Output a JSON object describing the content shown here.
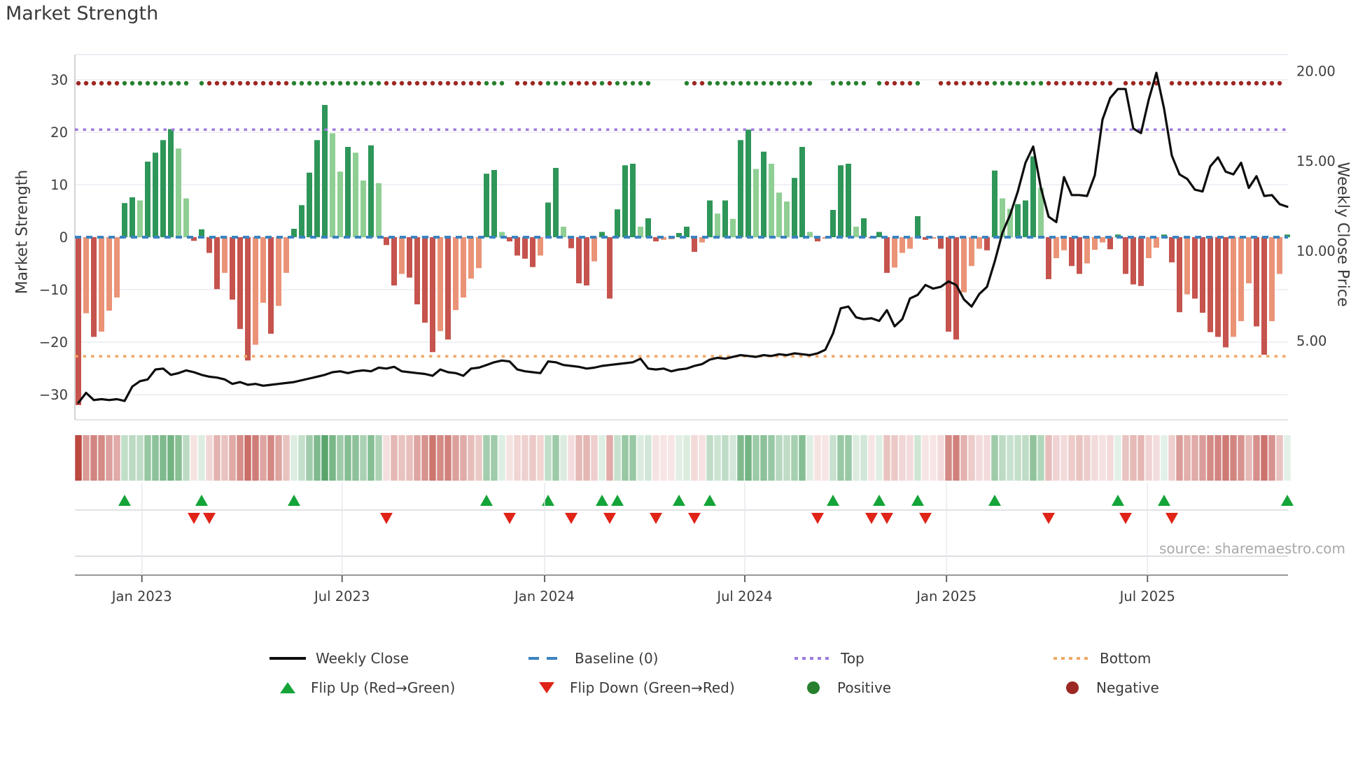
{
  "title": "Market Strength",
  "source": "source: sharemaestro.com",
  "axes": {
    "left_label": "Market Strength",
    "right_label": "Weekly Close Price",
    "left_ticks": [
      "30",
      "20",
      "10",
      "0",
      "−10",
      "−20",
      "−30"
    ],
    "left_tick_values": [
      30,
      20,
      10,
      0,
      -10,
      -20,
      -30
    ],
    "right_ticks": [
      "20.00",
      "15.00",
      "10.00",
      "5.00"
    ],
    "right_tick_values": [
      20,
      15,
      10,
      5
    ],
    "x_ticks": [
      "Jan 2023",
      "Jul 2023",
      "Jan 2024",
      "Jul 2024",
      "Jan 2025",
      "Jul 2025"
    ],
    "x_tick_weeks": [
      8.7,
      34.7,
      61.0,
      87.0,
      113.2,
      139.3
    ]
  },
  "legend": {
    "items": [
      {
        "label": "Weekly Close",
        "swatch": "line-black"
      },
      {
        "label": "Baseline (0)",
        "swatch": "blue-dashes"
      },
      {
        "label": "Top",
        "swatch": "purple-dots"
      },
      {
        "label": "Bottom",
        "swatch": "orange-dots"
      },
      {
        "label": "Flip Up (Red→Green)",
        "swatch": "green-up-triangle"
      },
      {
        "label": "Flip Down (Green→Red)",
        "swatch": "red-down-triangle"
      },
      {
        "label": "Positive",
        "swatch": "green-dot"
      },
      {
        "label": "Negative",
        "swatch": "dark-red-dot"
      }
    ]
  },
  "colors": {
    "bar_pos_strong": "#2e9658",
    "bar_pos_light": "#8fcf94",
    "bar_neg_strong": "#c6534d",
    "bar_neg_light": "#eb9377",
    "baseline": "#3b83c0",
    "top_line": "#9d7be0",
    "bottom_line": "#f0a866",
    "price_line": "#0d0d0d",
    "flip_up": "#14a438",
    "flip_down": "#e02418",
    "pos_dot": "#26802e",
    "neg_dot": "#9c2823",
    "heat_pos": "42,140,66",
    "heat_neg": "182,56,48",
    "grid": "#ebebf3",
    "spine": "#c9c9c9",
    "axis_line": "#8a8a8a",
    "tick_text": "#3d3d3d"
  },
  "chart_data": {
    "type": "bar",
    "subtype": "combo-bar-line-heatmap",
    "title": "Market Strength",
    "x_start_week": "2022-11-07",
    "x_frequency": "weekly",
    "xlabel": "",
    "ylabel_left": "Market Strength",
    "ylabel_right": "Weekly Close Price",
    "ylim_left": [
      -34.8,
      34.8
    ],
    "ylim_right": [
      0.6,
      20.9
    ],
    "baseline": 0,
    "top_threshold": 20.5,
    "bottom_threshold": -22.7,
    "legend_position": "bottom",
    "grid": true,
    "series": [
      {
        "name": "Market Strength",
        "type": "bar",
        "axis": "left"
      },
      {
        "name": "Weekly Close",
        "type": "line",
        "axis": "right"
      }
    ],
    "strength_values": [
      -32,
      -14.5,
      -19,
      -18,
      -14,
      -11.5,
      6.5,
      7.6,
      7.0,
      14.4,
      16.1,
      18.5,
      20.6,
      16.9,
      7.4,
      -0.7,
      1.5,
      -3.0,
      -9.9,
      -6.8,
      -11.9,
      -17.5,
      -23.5,
      -20.5,
      -12.5,
      -18.4,
      -13.1,
      -6.8,
      1.6,
      6.1,
      12.3,
      18.5,
      25.2,
      19.8,
      12.5,
      17.2,
      16.1,
      10.8,
      17.5,
      10.3,
      -1.5,
      -9.2,
      -7.0,
      -7.7,
      -12.8,
      -16.3,
      -21.9,
      -17.9,
      -19.5,
      -13.9,
      -11.5,
      -7.9,
      -5.9,
      12.1,
      12.8,
      1.0,
      -0.8,
      -3.5,
      -4.1,
      -5.7,
      -3.5,
      6.6,
      13.2,
      2.0,
      -2.1,
      -8.8,
      -9.2,
      -4.6,
      1.0,
      -11.7,
      5.3,
      13.7,
      14.0,
      2.0,
      3.6,
      -0.8,
      -0.5,
      -0.4,
      0.8,
      2.0,
      -2.8,
      -1.0,
      7.0,
      4.5,
      7.0,
      3.5,
      18.5,
      20.5,
      13.0,
      16.3,
      14.0,
      8.5,
      6.8,
      11.3,
      17.2,
      1.0,
      -0.8,
      -0.3,
      5.2,
      13.7,
      14.0,
      2.0,
      3.6,
      -0.2,
      1.0,
      -6.8,
      -5.8,
      -3.0,
      -2.2,
      4.0,
      -0.5,
      -0.3,
      -2.2,
      -18.0,
      -19.5,
      -10.5,
      -5.5,
      -2.2,
      -2.5,
      12.7,
      7.4,
      5.4,
      6.3,
      7.0,
      15.4,
      9.4,
      -8.0,
      -4.0,
      -2.5,
      -5.5,
      -7.0,
      -5.0,
      -2.4,
      -1.0,
      -2.3,
      0.5,
      -7.0,
      -9.0,
      -9.3,
      -4.0,
      -2.0,
      0.5,
      -4.8,
      -14.3,
      -10.9,
      -11.7,
      -14.4,
      -18.1,
      -19.0,
      -21.0,
      -19.0,
      -16.0,
      -8.8,
      -17.0,
      -22.4,
      -16.0,
      -7.0,
      0.5
    ],
    "weekly_close": [
      1.55,
      2.1,
      1.7,
      1.75,
      1.7,
      1.75,
      1.65,
      2.45,
      2.75,
      2.85,
      3.4,
      3.45,
      3.1,
      3.2,
      3.35,
      3.25,
      3.1,
      3.0,
      2.95,
      2.85,
      2.6,
      2.7,
      2.55,
      2.6,
      2.5,
      2.55,
      2.6,
      2.65,
      2.7,
      2.8,
      2.9,
      3.0,
      3.1,
      3.25,
      3.3,
      3.2,
      3.3,
      3.35,
      3.3,
      3.5,
      3.45,
      3.55,
      3.3,
      3.25,
      3.2,
      3.15,
      3.05,
      3.4,
      3.25,
      3.2,
      3.05,
      3.45,
      3.5,
      3.65,
      3.8,
      3.9,
      3.85,
      3.4,
      3.3,
      3.25,
      3.2,
      3.85,
      3.8,
      3.65,
      3.6,
      3.55,
      3.45,
      3.5,
      3.6,
      3.65,
      3.7,
      3.75,
      3.8,
      4.0,
      3.45,
      3.4,
      3.45,
      3.3,
      3.4,
      3.45,
      3.6,
      3.7,
      3.95,
      4.05,
      4.0,
      4.1,
      4.2,
      4.15,
      4.1,
      4.2,
      4.15,
      4.25,
      4.2,
      4.3,
      4.25,
      4.2,
      4.3,
      4.5,
      5.4,
      6.8,
      6.9,
      6.3,
      6.2,
      6.25,
      6.1,
      6.7,
      5.8,
      6.2,
      7.35,
      7.55,
      8.1,
      7.9,
      8.0,
      8.3,
      8.1,
      7.3,
      6.9,
      7.6,
      8.0,
      9.4,
      11.0,
      12.0,
      13.3,
      14.9,
      15.8,
      13.5,
      11.9,
      11.6,
      14.1,
      13.1,
      13.1,
      13.05,
      14.2,
      17.3,
      18.5,
      19.0,
      19.0,
      16.8,
      16.55,
      18.4,
      19.9,
      17.9,
      15.3,
      14.25,
      14.0,
      13.4,
      13.3,
      14.7,
      15.2,
      14.4,
      14.25,
      14.9,
      13.5,
      14.15,
      13.05,
      13.1,
      12.6,
      12.45
    ],
    "annotations": {
      "flip_up_rule": "week where strength flips from negative to positive",
      "flip_down_rule": "week where strength flips from positive to negative",
      "heatmap": "weekly strength rendered as red-green intensity strip",
      "dot_row": "positive/negative dot per week along top of plot"
    }
  }
}
